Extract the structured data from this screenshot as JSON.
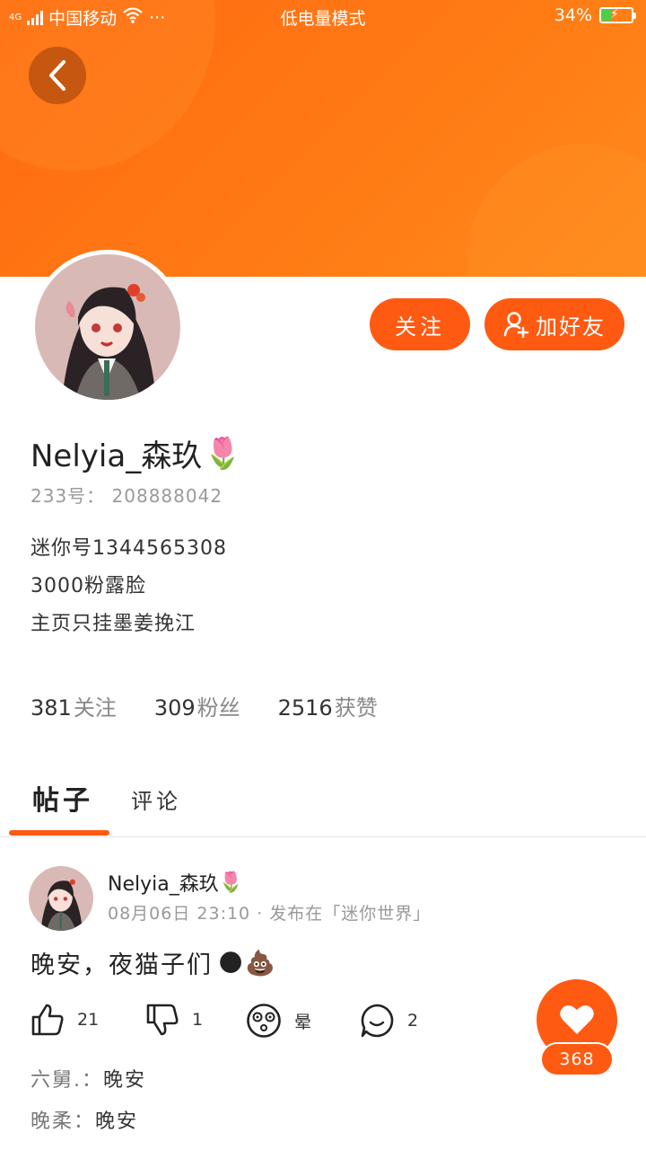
{
  "status_bar": {
    "network": "4G",
    "carrier": "中国移动",
    "more": "···",
    "mode": "低电量模式",
    "battery_percent": "34%",
    "battery_level": 0.34
  },
  "profile": {
    "name": "Nelyia_森玖",
    "name_emoji": "🌷",
    "uid": "233号： 208888042",
    "bio_lines": [
      "迷你号1344565308",
      "3000粉露脸",
      "主页只挂墨姜挽江"
    ],
    "follow_label": "关注",
    "add_friend_label": "加好友"
  },
  "stats": {
    "following_count": "381",
    "following_label": "关注",
    "fans_count": "309",
    "fans_label": "粉丝",
    "likes_count": "2516",
    "likes_label": "获赞"
  },
  "tabs": {
    "posts": "帖子",
    "comments": "评论"
  },
  "post": {
    "author": "Nelyia_森玖",
    "author_emoji": "🌷",
    "meta": "08月06日 23:10 · 发布在「迷你世界」",
    "content": "晚安，夜猫子们",
    "content_emojis": "🌑💩",
    "up_count": "21",
    "down_count": "1",
    "dizzy_label": "晕",
    "comment_count": "2",
    "like_total": "368"
  },
  "comments": [
    {
      "name": "六舅.：",
      "text": "晚安"
    },
    {
      "name": "晚柔：",
      "text": "晚安"
    }
  ],
  "colors": {
    "accent": "#ff5a12",
    "banner": "#ff7a14"
  }
}
